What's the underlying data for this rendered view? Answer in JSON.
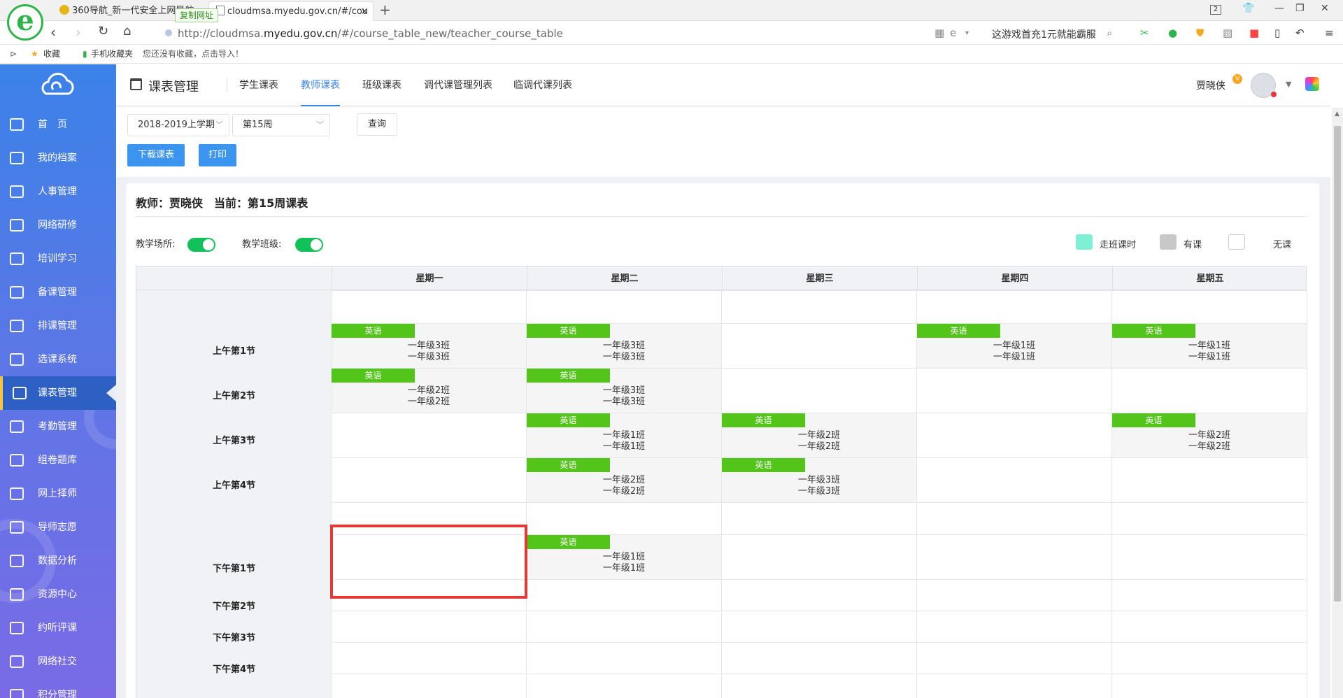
{
  "browser": {
    "tabs": [
      {
        "title": "360导航_新一代安全上网导航"
      },
      {
        "title": "cloudmsa.myedu.gov.cn/#/cou"
      }
    ],
    "copy_tip": "复制网址",
    "tab_count": "2",
    "url_pre": "http://cloudmsa.",
    "url_host": "myedu.gov.cn",
    "url_post": "/#/course_table_new/teacher_course_table",
    "promo": "这游戏首充1元就能霸服",
    "fav_label": "收藏",
    "fav_mobile": "手机收藏夹",
    "fav_hint": "您还没有收藏，点击导入！"
  },
  "sidebar": {
    "items": [
      {
        "label": "首　页"
      },
      {
        "label": "我的档案"
      },
      {
        "label": "人事管理"
      },
      {
        "label": "网络研修"
      },
      {
        "label": "培训学习"
      },
      {
        "label": "备课管理"
      },
      {
        "label": "排课管理"
      },
      {
        "label": "选课系统"
      },
      {
        "label": "课表管理"
      },
      {
        "label": "考勤管理"
      },
      {
        "label": "组卷题库"
      },
      {
        "label": "网上择师"
      },
      {
        "label": "导师志愿"
      },
      {
        "label": "数据分析"
      },
      {
        "label": "资源中心"
      },
      {
        "label": "约听评课"
      },
      {
        "label": "网络社交"
      },
      {
        "label": "积分管理"
      }
    ],
    "active_index": 8
  },
  "header": {
    "title": "课表管理",
    "tabs": [
      {
        "label": "学生课表"
      },
      {
        "label": "教师课表"
      },
      {
        "label": "班级课表"
      },
      {
        "label": "调代课管理列表"
      },
      {
        "label": "临调代课列表"
      }
    ],
    "active_tab": 1,
    "user_name": "贾晓侠",
    "user_badge": "V"
  },
  "filters": {
    "term": "2018-2019上学期",
    "week": "第15周",
    "query_label": "查询",
    "download_label": "下载课表",
    "print_label": "打印"
  },
  "panel": {
    "teacher": "教师：贾晓侠",
    "current": "当前：第15周课表",
    "toggle_place": "教学场所:",
    "toggle_class": "教学班级:",
    "legend": [
      {
        "label": "走班课时",
        "color": "#7ff0d4"
      },
      {
        "label": "有课",
        "color": "#c8c8c8"
      },
      {
        "label": "无课",
        "color": "#ffffff"
      }
    ]
  },
  "timetable": {
    "days": [
      "星期一",
      "星期二",
      "星期三",
      "星期四",
      "星期五"
    ],
    "periods": [
      "上午第1节",
      "上午第2节",
      "上午第3节",
      "上午第4节",
      "下午第1节",
      "下午第2节",
      "下午第3节",
      "下午第4节"
    ],
    "lessons": [
      {
        "day": 0,
        "period": 0,
        "subject": "英语",
        "class1": "一年级3班",
        "class2": "一年级3班"
      },
      {
        "day": 1,
        "period": 0,
        "subject": "英语",
        "class1": "一年级3班",
        "class2": "一年级3班"
      },
      {
        "day": 3,
        "period": 0,
        "subject": "英语",
        "class1": "一年级1班",
        "class2": "一年级1班"
      },
      {
        "day": 4,
        "period": 0,
        "subject": "英语",
        "class1": "一年级1班",
        "class2": "一年级1班"
      },
      {
        "day": 0,
        "period": 1,
        "subject": "英语",
        "class1": "一年级2班",
        "class2": "一年级2班"
      },
      {
        "day": 1,
        "period": 1,
        "subject": "英语",
        "class1": "一年级3班",
        "class2": "一年级3班"
      },
      {
        "day": 1,
        "period": 2,
        "subject": "英语",
        "class1": "一年级1班",
        "class2": "一年级1班"
      },
      {
        "day": 2,
        "period": 2,
        "subject": "英语",
        "class1": "一年级2班",
        "class2": "一年级2班"
      },
      {
        "day": 4,
        "period": 2,
        "subject": "英语",
        "class1": "一年级2班",
        "class2": "一年级2班"
      },
      {
        "day": 1,
        "period": 3,
        "subject": "英语",
        "class1": "一年级2班",
        "class2": "一年级2班"
      },
      {
        "day": 2,
        "period": 3,
        "subject": "英语",
        "class1": "一年级3班",
        "class2": "一年级3班"
      },
      {
        "day": 1,
        "period": 4,
        "subject": "英语",
        "class1": "一年级1班",
        "class2": "一年级1班"
      }
    ]
  }
}
